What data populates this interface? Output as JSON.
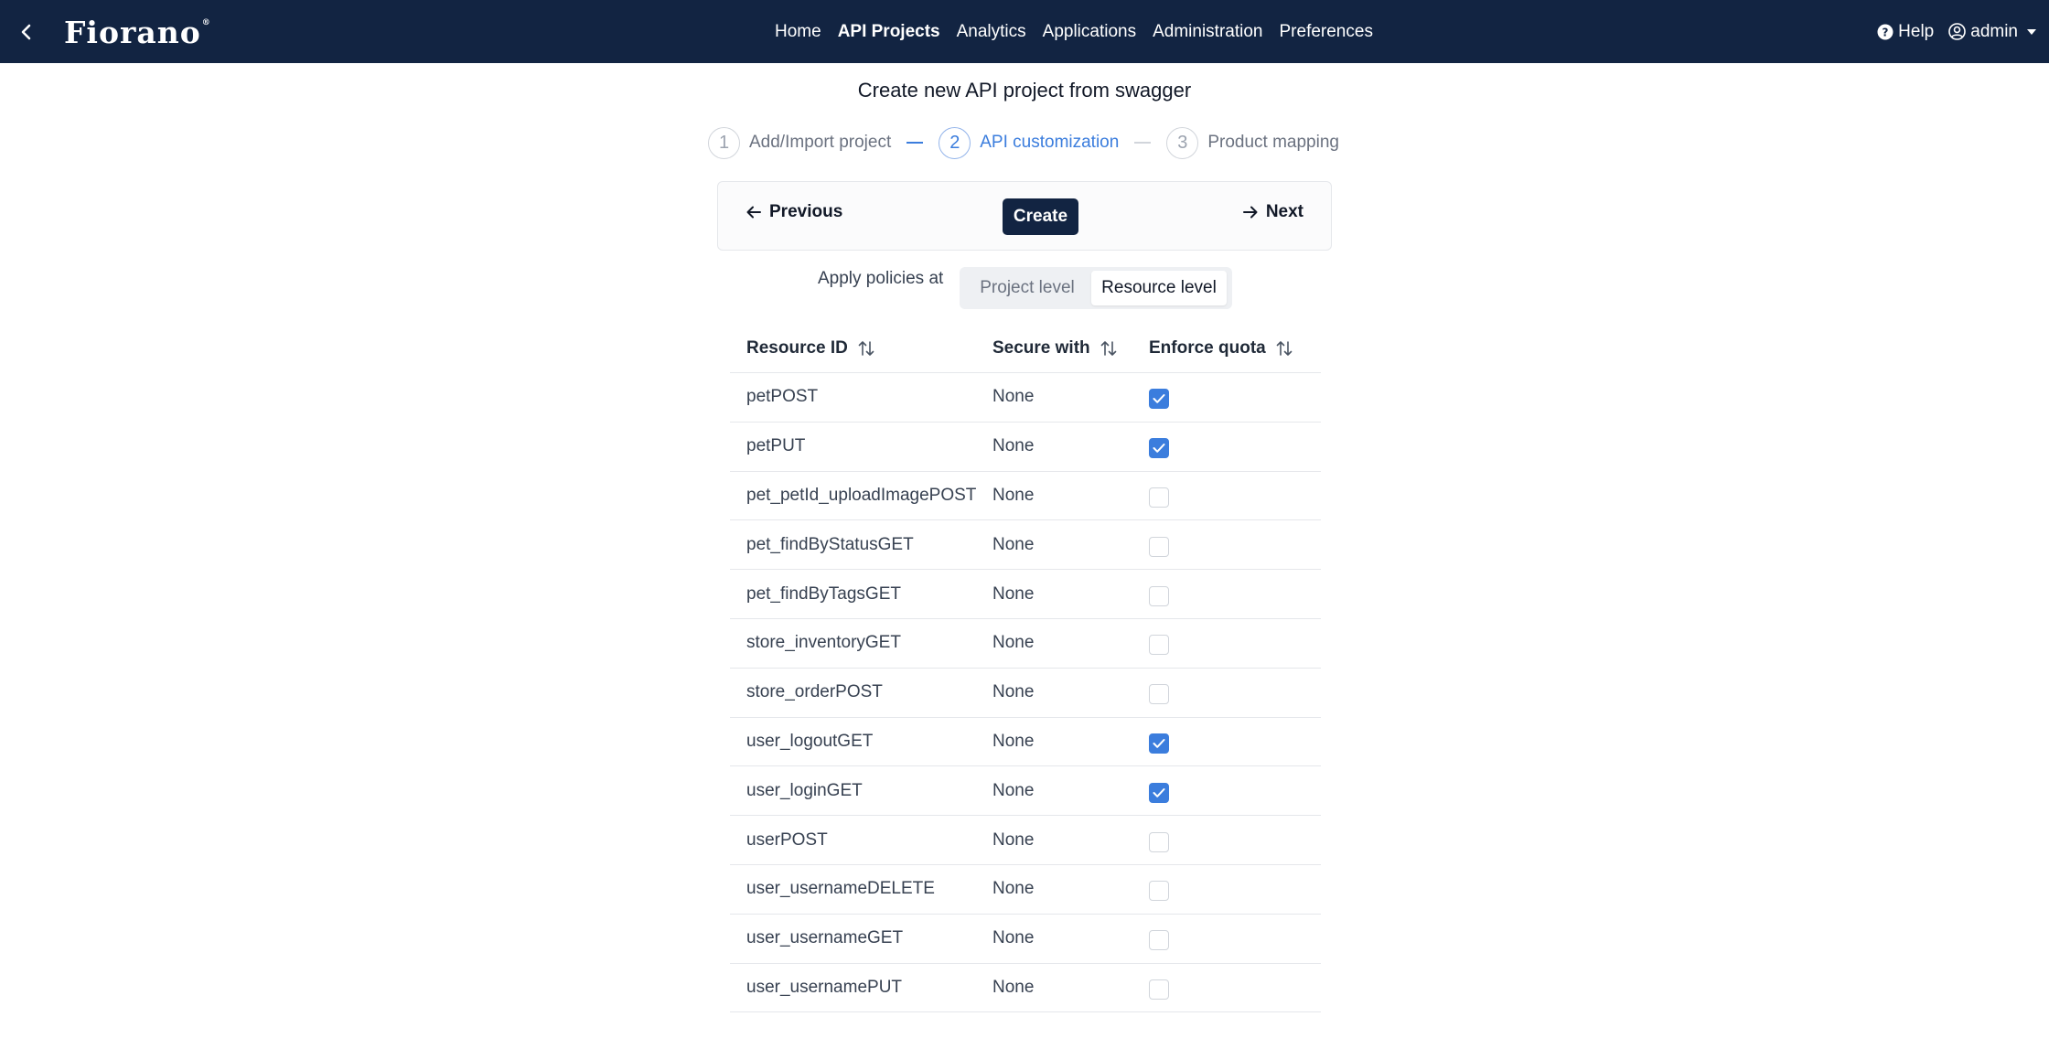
{
  "navbar": {
    "logo": "Fiorano",
    "logo_mark": "®",
    "menu": [
      {
        "label": "Home",
        "active": false
      },
      {
        "label": "API Projects",
        "active": true
      },
      {
        "label": "Analytics",
        "active": false
      },
      {
        "label": "Applications",
        "active": false
      },
      {
        "label": "Administration",
        "active": false
      },
      {
        "label": "Preferences",
        "active": false
      }
    ],
    "help_label": "Help",
    "user_label": "admin"
  },
  "page": {
    "title": "Create new API project from swagger"
  },
  "stepper": {
    "steps": [
      {
        "num": "1",
        "label": "Add/Import project",
        "active": false
      },
      {
        "num": "2",
        "label": "API customization",
        "active": true
      },
      {
        "num": "3",
        "label": "Product mapping",
        "active": false
      }
    ]
  },
  "actions": {
    "previous_label": "Previous",
    "create_label": "Create",
    "next_label": "Next"
  },
  "policies": {
    "label": "Apply policies at",
    "options": [
      "Project level",
      "Resource level"
    ],
    "selected": "Resource level"
  },
  "table": {
    "columns": [
      "Resource ID",
      "Secure with",
      "Enforce quota"
    ],
    "rows": [
      {
        "id": "petPOST",
        "secure": "None",
        "quota": true
      },
      {
        "id": "petPUT",
        "secure": "None",
        "quota": true
      },
      {
        "id": "pet_petId_uploadImagePOST",
        "secure": "None",
        "quota": false
      },
      {
        "id": "pet_findByStatusGET",
        "secure": "None",
        "quota": false
      },
      {
        "id": "pet_findByTagsGET",
        "secure": "None",
        "quota": false
      },
      {
        "id": "store_inventoryGET",
        "secure": "None",
        "quota": false
      },
      {
        "id": "store_orderPOST",
        "secure": "None",
        "quota": false
      },
      {
        "id": "user_logoutGET",
        "secure": "None",
        "quota": true
      },
      {
        "id": "user_loginGET",
        "secure": "None",
        "quota": true
      },
      {
        "id": "userPOST",
        "secure": "None",
        "quota": false
      },
      {
        "id": "user_usernameDELETE",
        "secure": "None",
        "quota": false
      },
      {
        "id": "user_usernameGET",
        "secure": "None",
        "quota": false
      },
      {
        "id": "user_usernamePUT",
        "secure": "None",
        "quota": false
      }
    ]
  },
  "colors": {
    "navbar_bg": "#122442",
    "accent": "#3b7ddd",
    "create_bg": "#122442"
  },
  "icons": {
    "back": "chevron-left-icon",
    "help": "question-circle-icon",
    "user": "user-circle-icon",
    "previous": "arrow-left-icon",
    "next": "arrow-right-icon",
    "sort": "sort-arrows-icon",
    "check": "check-icon"
  }
}
